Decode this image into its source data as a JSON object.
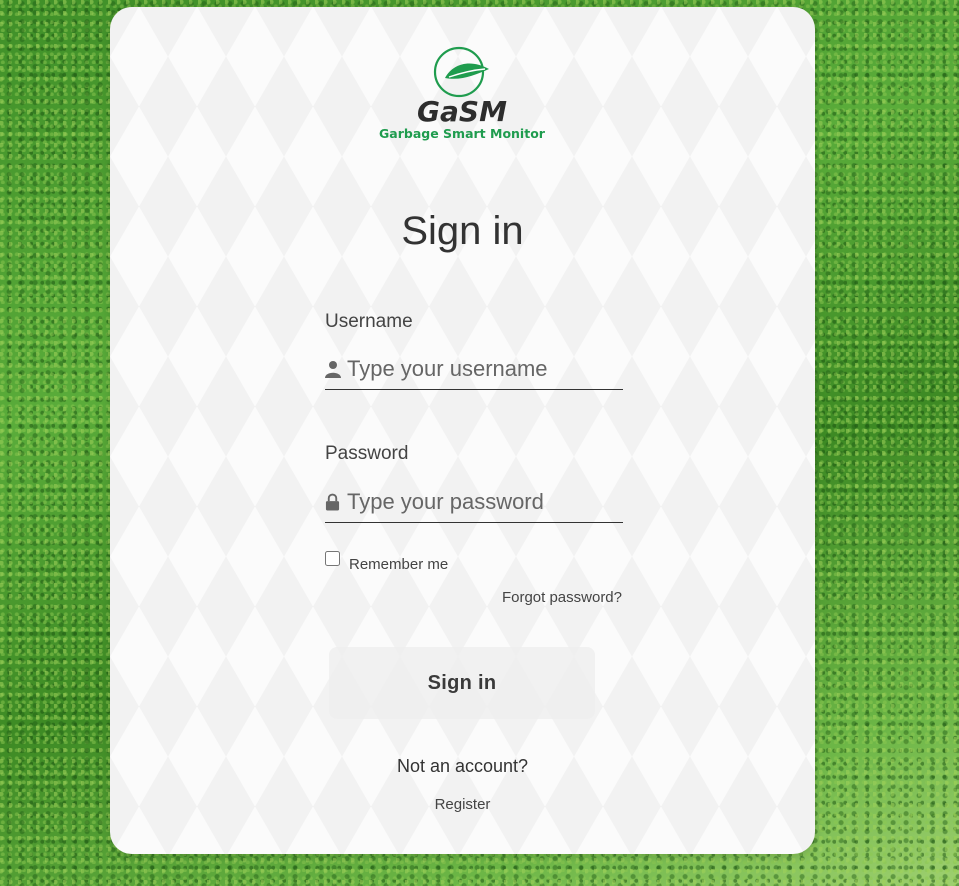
{
  "logo": {
    "name": "GaSM",
    "tagline": "Garbage Smart Monitor",
    "brand_color": "#1f9c4e"
  },
  "form": {
    "title": "Sign in",
    "username": {
      "label": "Username",
      "placeholder": "Type your username",
      "icon": "user-icon"
    },
    "password": {
      "label": "Password",
      "placeholder": "Type your password",
      "icon": "lock-icon"
    },
    "remember_label": "Remember me",
    "forgot_label": "Forgot password?",
    "submit_label": "Sign in",
    "no_account_text": "Not an account?",
    "register_label": "Register"
  }
}
